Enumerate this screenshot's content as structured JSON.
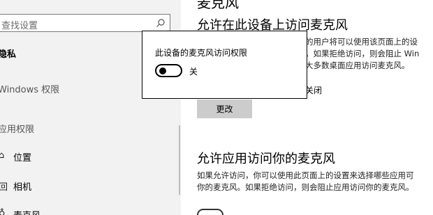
{
  "sidebar": {
    "search_placeholder": "查找设置",
    "section_title": "隐私",
    "items": [
      {
        "label": "Windows 权限"
      },
      {
        "label": "应用权限"
      },
      {
        "label": "位置",
        "icon": "location-icon"
      },
      {
        "label": "相机",
        "icon": "camera-icon"
      },
      {
        "label": "麦克风",
        "icon": "microphone-icon"
      }
    ]
  },
  "main": {
    "top_heading": "麦克风",
    "section1_title": "允许在此设备上访问麦克风",
    "section1_lines": [
      "的用户将可以使用该页面上的设",
      "。如果拒绝访问，则会阻止 Win",
      "大多数桌面应用访问麦克风。"
    ],
    "status_suffix": "关闭",
    "change_button": "更改",
    "section2_title": "允许应用访问你的麦克风",
    "section2_lines": [
      "如果允许访问，你可以使用此页面上的设置来选择哪些应用可",
      "你的麦克风。如果拒绝访问，则会阻止应用访问你的麦克风。"
    ]
  },
  "dialog": {
    "title": "此设备的麦克风访问权限",
    "toggle_state": "关",
    "toggle_on": false
  }
}
